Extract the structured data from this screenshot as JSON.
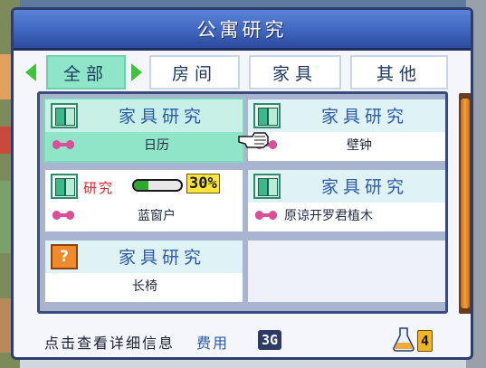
{
  "window": {
    "title": "公寓研究"
  },
  "tabs": [
    {
      "label": "全部",
      "active": true
    },
    {
      "label": "房间",
      "active": false
    },
    {
      "label": "家具",
      "active": false
    },
    {
      "label": "其他",
      "active": false
    }
  ],
  "items": [
    {
      "header": "家具研究",
      "name": "日历",
      "icon": "book-icon",
      "selected": true
    },
    {
      "header": "家具研究",
      "name": "壁钟",
      "icon": "book-icon"
    },
    {
      "header_research": "研究",
      "progress_pct": "30%",
      "progress_fraction": 0.3,
      "name": "蓝窗户",
      "icon": "book-icon"
    },
    {
      "header": "家具研究",
      "name": "原谅开罗君植木",
      "icon": "book-icon"
    },
    {
      "header": "家具研究",
      "name": "长椅",
      "icon": "question-icon"
    }
  ],
  "footer": {
    "hint": "点击查看详细信息",
    "cost_label": "费用",
    "cost_value": "3G",
    "flask_value": "4"
  },
  "colors": {
    "title_bar": "#3f66c0",
    "tab_active": "#8fe5c8",
    "header_text": "#2a5aa8",
    "research_red": "#d42a2a",
    "progress_green": "#2ea82e"
  }
}
